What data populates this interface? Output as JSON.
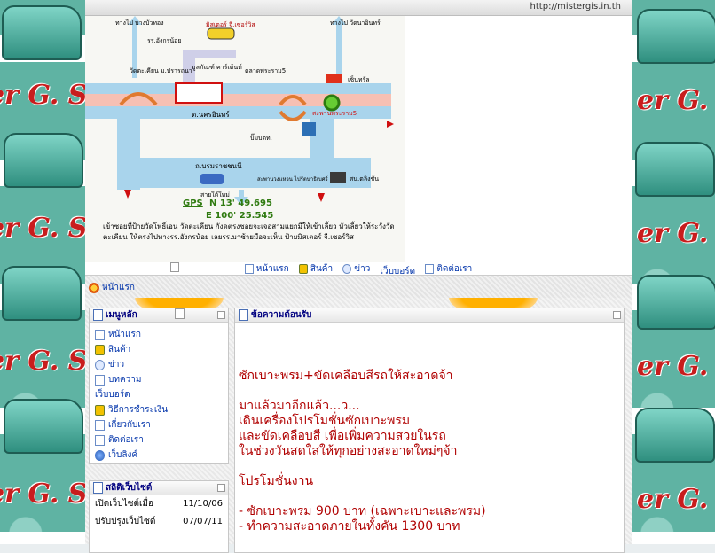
{
  "browser": {
    "url": "http://mistergis.in.th"
  },
  "map": {
    "labels": [
      "ทางไป บางบัวทอง",
      "รร.อังกรน้อย",
      "มิสเตอร์ จี.เซอร์วิส",
      "ทางไป วัดนาอินทร์",
      "วัดตะเคียน ม.ปรารถนา",
      "มูลภัณฑ์ คาร์เต้นท์",
      "ตลาดพระราม5",
      "เซ็นทรัล",
      "ต.นครอินทร์",
      "ปั๊มปตท.",
      "สะพานพระราม5",
      "ถ.บรมราชชนนี",
      "สะพานวงแหวน ไปรัตนาธิเบศร์",
      "สน.ตลิ่งชัน",
      "สายใต้ใหม่"
    ],
    "gps_label": "GPS",
    "gps_n": "N   13' 49.695",
    "gps_e": "E  100' 25.545",
    "directions": "เข้าซอยที่ป้ายวัดโพธิ์เอน วัดตะเคียน กังดตรงซอยจะเจอสามแยกมีให้เข้าเลี้ยว หัวเลี้ยวให้ระวังวัดตะเคียน ให้ตรงไปทางรร.อังกรน้อย เลยรร.มาซ้ายมือจะเห็น ป้ายมิสเตอร์ จี.เซอร์วิส"
  },
  "nav": {
    "items": [
      {
        "label": "หน้าแรก",
        "icon": "doc-icon"
      },
      {
        "label": "สินค้า",
        "icon": "cart-icon"
      },
      {
        "label": "ข่าว",
        "icon": "bubble-icon"
      },
      {
        "label": "เว็บบอร์ด",
        "icon": "page-icon"
      },
      {
        "label": "ติดต่อเรา",
        "icon": "doc-icon"
      }
    ]
  },
  "breadcrumb": {
    "home_label": "หน้าแรก"
  },
  "main_menu": {
    "title": "เมนูหลัก",
    "items": [
      {
        "label": "หน้าแรก",
        "icon": "doc"
      },
      {
        "label": "สินค้า",
        "icon": "cart"
      },
      {
        "label": "ข่าว",
        "icon": "bubble"
      },
      {
        "label": "บทความ",
        "icon": "doc"
      },
      {
        "label": "เว็บบอร์ด",
        "icon": "page"
      },
      {
        "label": "วิธีการชำระเงิน",
        "icon": "cart"
      },
      {
        "label": "เกี่ยวกับเรา",
        "icon": "doc"
      },
      {
        "label": "ติดต่อเรา",
        "icon": "doc"
      },
      {
        "label": "เว็บลิงค์",
        "icon": "globe"
      }
    ]
  },
  "stats": {
    "title": "สถิติเว็บไซต์",
    "rows": [
      {
        "label": "เปิดเว็บไซต์เมื่อ",
        "value": "11/10/06"
      },
      {
        "label": "ปรับปรุงเว็บไซต์",
        "value": "07/07/11"
      }
    ]
  },
  "welcome": {
    "title": "ข้อความต้อนรับ",
    "lines": [
      "ซักเบาะพรม+ขัดเคลือบสีรถให้สะอาดจ้า",
      "",
      "มาแล้วมาอีกแล้ว...ว...",
      "เดินเครื่องโปรโมชั่นซักเบาะพรม",
      "และขัดเคลือบสี เพื่อเพิ่มความสวยในรถ",
      "ในช่วงวันสดใสให้ทุกอย่างสะอาดใหม่ๆจ้า",
      "",
      "โปรโมชั่นงาน",
      "",
      "- ซักเบาะพรม 900 บาท (เฉพาะเบาะและพรม)",
      "- ทำความสะอาดภายในทั้งคัน 1300 บาท"
    ]
  },
  "colors": {
    "link": "#0033aa",
    "article": "#b00000",
    "header_text": "#000080"
  }
}
